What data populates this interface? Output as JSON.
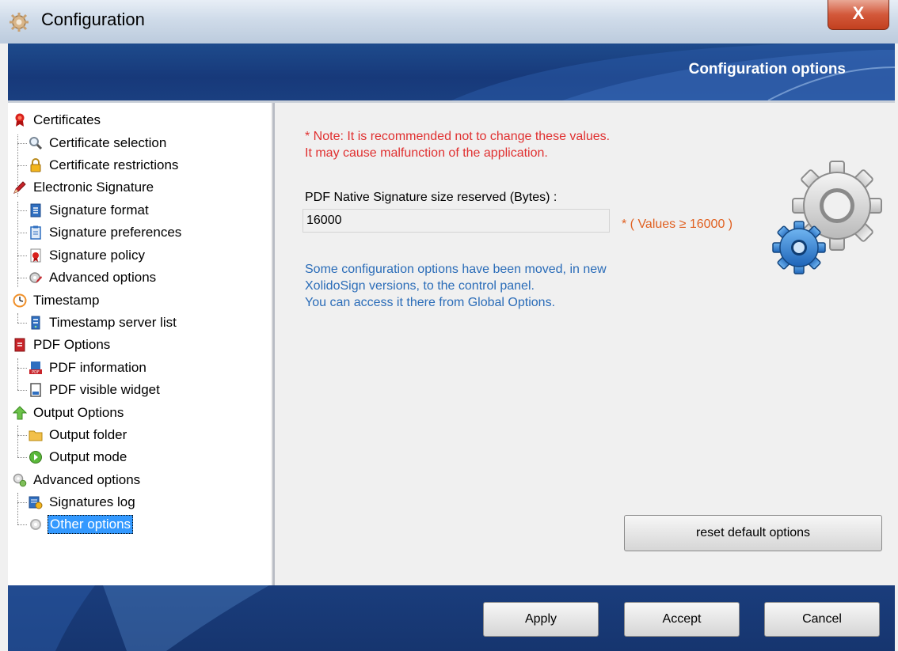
{
  "window": {
    "title": "Configuration",
    "close_glyph": "X"
  },
  "banner": {
    "title": "Configuration options"
  },
  "tree": [
    {
      "label": "Certificates",
      "icon": "ribbon-icon",
      "level": 0
    },
    {
      "label": "Certificate selection",
      "icon": "magnifier-icon",
      "level": 1
    },
    {
      "label": "Certificate restrictions",
      "icon": "lock-icon",
      "level": 1
    },
    {
      "label": "Electronic Signature",
      "icon": "pen-icon",
      "level": 0
    },
    {
      "label": "Signature format",
      "icon": "document-icon",
      "level": 1
    },
    {
      "label": "Signature preferences",
      "icon": "clipboard-icon",
      "level": 1
    },
    {
      "label": "Signature policy",
      "icon": "policy-document-icon",
      "level": 1
    },
    {
      "label": "Advanced options",
      "icon": "gear-pen-icon",
      "level": 1
    },
    {
      "label": "Timestamp",
      "icon": "clock-icon",
      "level": 0
    },
    {
      "label": "Timestamp server list",
      "icon": "server-icon",
      "level": 1
    },
    {
      "label": "PDF Options",
      "icon": "pdf-icon",
      "level": 0
    },
    {
      "label": "PDF information",
      "icon": "pdf-info-icon",
      "level": 1
    },
    {
      "label": "PDF visible widget",
      "icon": "pdf-widget-icon",
      "level": 1
    },
    {
      "label": "Output Options",
      "icon": "up-arrow-icon",
      "level": 0
    },
    {
      "label": "Output folder",
      "icon": "folder-icon",
      "level": 1
    },
    {
      "label": "Output mode",
      "icon": "green-circle-icon",
      "level": 1
    },
    {
      "label": "Advanced options",
      "icon": "gears-icon",
      "level": 0
    },
    {
      "label": "Signatures log",
      "icon": "log-icon",
      "level": 1
    },
    {
      "label": "Other options",
      "icon": "gear-icon",
      "level": 1,
      "selected": true
    }
  ],
  "content": {
    "note_line1": "* Note: It is recommended not to change these values.",
    "note_line2": "It may cause malfunction of the application.",
    "field_label": "PDF Native Signature size reserved (Bytes) :",
    "field_value": "16000",
    "hint": "* ( Values ≥ 16000 )",
    "info_line1": "Some configuration options have been moved, in new",
    "info_line2": "XolidoSign versions, to the control panel.",
    "info_line3": "You can access it there from Global Options.",
    "reset_label": "reset default options"
  },
  "footer": {
    "apply_label": "Apply",
    "accept_label": "Accept",
    "cancel_label": "Cancel"
  },
  "colors": {
    "banner": "#17397a",
    "note_red": "#e03030",
    "hint_orange": "#e06020",
    "info_blue": "#2a6cb8",
    "selection": "#3399ff"
  }
}
